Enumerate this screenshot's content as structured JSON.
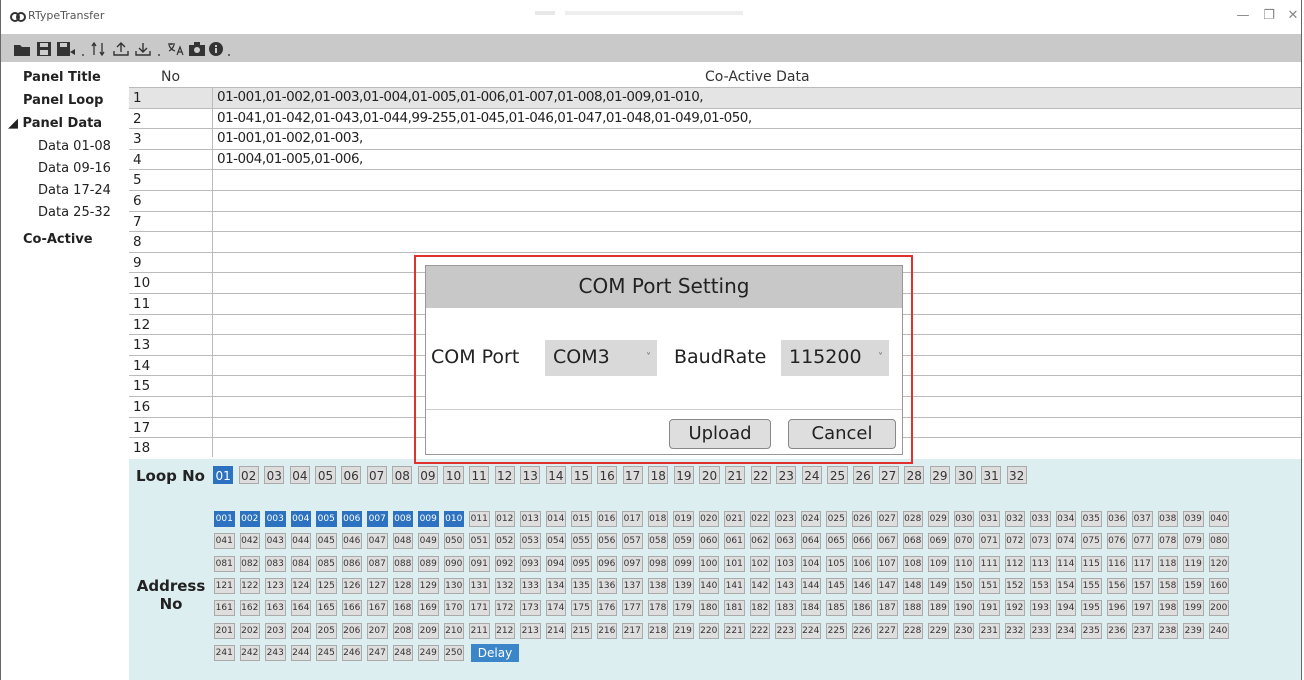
{
  "window": {
    "title": "RTypeTransfer"
  },
  "toolbar": {
    "icons": [
      "open-folder-icon",
      "save-icon",
      "save-as-icon",
      "sort-icon",
      "upload-icon",
      "download-icon",
      "translate-icon",
      "camera-icon",
      "info-icon"
    ]
  },
  "sidebar": {
    "items": [
      {
        "label": "Panel Title"
      },
      {
        "label": "Panel Loop"
      },
      {
        "label": "◢ Panel Data"
      },
      {
        "label": "Data 01-08"
      },
      {
        "label": "Data 09-16"
      },
      {
        "label": "Data 17-24"
      },
      {
        "label": "Data 25-32"
      },
      {
        "label": "Co-Active"
      }
    ]
  },
  "grid": {
    "col_no": "No",
    "col_data": "Co-Active Data",
    "rows": [
      {
        "no": "1",
        "data": "01-001,01-002,01-003,01-004,01-005,01-006,01-007,01-008,01-009,01-010,"
      },
      {
        "no": "2",
        "data": "01-041,01-042,01-043,01-044,99-255,01-045,01-046,01-047,01-048,01-049,01-050,"
      },
      {
        "no": "3",
        "data": "01-001,01-002,01-003,"
      },
      {
        "no": "4",
        "data": "01-004,01-005,01-006,"
      },
      {
        "no": "5",
        "data": ""
      },
      {
        "no": "6",
        "data": ""
      },
      {
        "no": "7",
        "data": ""
      },
      {
        "no": "8",
        "data": ""
      },
      {
        "no": "9",
        "data": ""
      },
      {
        "no": "10",
        "data": ""
      },
      {
        "no": "11",
        "data": ""
      },
      {
        "no": "12",
        "data": ""
      },
      {
        "no": "13",
        "data": ""
      },
      {
        "no": "14",
        "data": ""
      },
      {
        "no": "15",
        "data": ""
      },
      {
        "no": "16",
        "data": ""
      },
      {
        "no": "17",
        "data": ""
      },
      {
        "no": "18",
        "data": ""
      }
    ]
  },
  "loop": {
    "label": "Loop No",
    "selected": "01",
    "items": [
      "01",
      "02",
      "03",
      "04",
      "05",
      "06",
      "07",
      "08",
      "09",
      "10",
      "11",
      "12",
      "13",
      "14",
      "15",
      "16",
      "17",
      "18",
      "19",
      "20",
      "21",
      "22",
      "23",
      "24",
      "25",
      "26",
      "27",
      "28",
      "29",
      "30",
      "31",
      "32"
    ]
  },
  "address": {
    "label_line1": "Address",
    "label_line2": "No",
    "selected": [
      "001",
      "002",
      "003",
      "004",
      "005",
      "006",
      "007",
      "008",
      "009",
      "010"
    ],
    "count": 250,
    "delay_label": "Delay"
  },
  "dialog": {
    "title": "COM Port Setting",
    "com_port_label": "COM Port",
    "com_port_value": "COM3",
    "baud_label": "BaudRate",
    "baud_value": "115200",
    "upload_label": "Upload",
    "cancel_label": "Cancel"
  },
  "colors": {
    "accent": "#2c72c0",
    "highlight_border": "#e03030",
    "panel_bg": "#dceef0"
  }
}
